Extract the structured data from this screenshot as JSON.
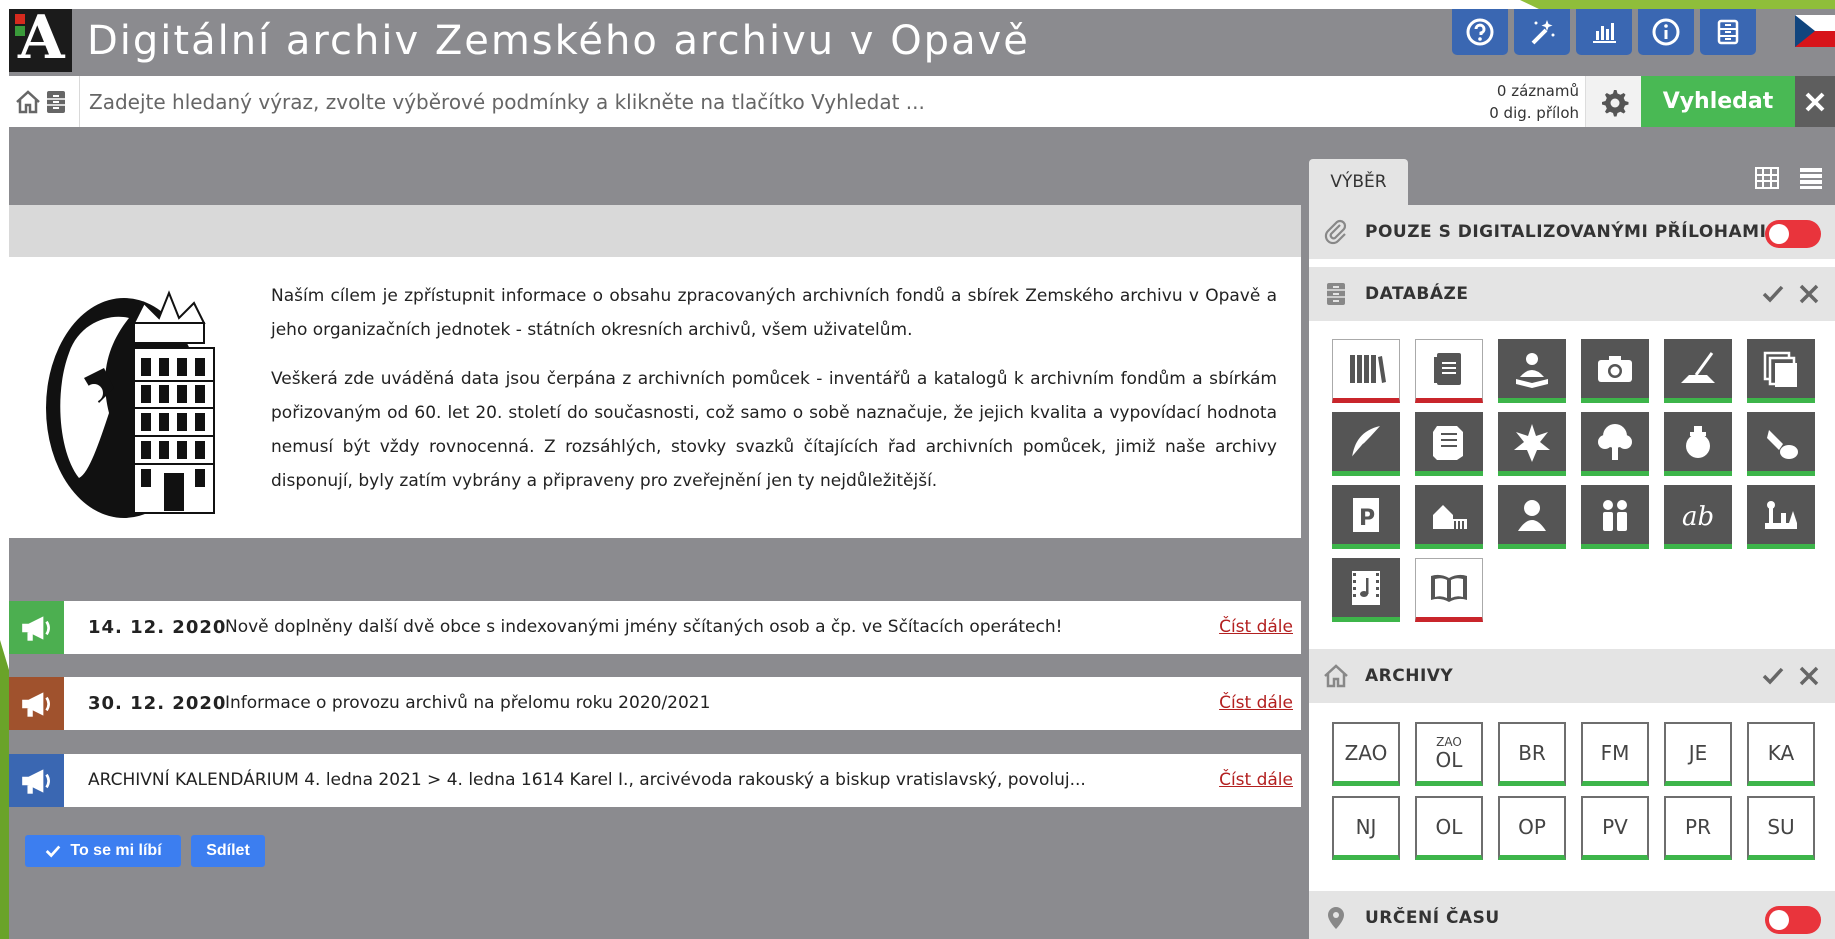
{
  "header": {
    "title": "Digitální archiv  Zemského archivu v Opavě",
    "logo_letter": "A",
    "buttons": [
      {
        "name": "help-button",
        "icon": "question-icon"
      },
      {
        "name": "magic-wand-button",
        "icon": "magic-wand-icon"
      },
      {
        "name": "statistics-button",
        "icon": "bar-chart-icon"
      },
      {
        "name": "info-button",
        "icon": "info-icon"
      },
      {
        "name": "archive-button",
        "icon": "cabinet-icon"
      }
    ],
    "language_flag": "czech-flag-icon",
    "button_color": "#3a67b2"
  },
  "search": {
    "placeholder": "Zadejte hledaný výraz, zvolte výběrové podmínky a klikněte na tlačítko Vyhledat ...",
    "records": "0 záznamů",
    "attachments": "0 dig. příloh",
    "search_label": "Vyhledat",
    "search_color": "#49b954"
  },
  "intro": {
    "paragraph1": "Naším cílem je zpřístupnit informace o obsahu zpracovaných archivních fondů a sbírek Zemského archivu v Opavě a jeho organizačních jednotek - státních okresních archivů, všem uživatelům.",
    "paragraph2": "Veškerá zde uváděná data jsou čerpána z archivních pomůcek - inventářů a katalogů k archivním fondům a sbírkám pořizovaným od 60. let 20. století do současnosti, což samo o sobě naznačuje, že jejich kvalita a vypovídací hodnota nemusí být vždy rovnocenná. Z rozsáhlých, stovky svazků čítajících řad archivních pomůcek, jimiž naše archivy disponují, byly zatím vybrány a připraveny pro zveřejnění jen ty nejdůležitější."
  },
  "news": [
    {
      "date": "14. 12. 2020",
      "text": "Nově doplněny další dvě obce s indexovanými jmény sčítaných osob a čp. ve Sčítacích operátech!",
      "more": "Číst dále",
      "color": "#4caf50"
    },
    {
      "date": "30. 12. 2020",
      "text": "Informace o provozu archivů na přelomu roku 2020/2021",
      "more": "Číst dále",
      "color": "#a0522d"
    },
    {
      "date": "",
      "text": "ARCHIVNÍ KALENDÁRIUM 4. ledna 2021 > 4. ledna 1614 Karel I., arcivévoda rakouský a biskup vratislavský, povoluj...",
      "more": "Číst dále",
      "color": "#3a67b2"
    }
  ],
  "social": {
    "like": "To se mi líbí",
    "share": "Sdílet"
  },
  "panel": {
    "tab": "VÝBĚR",
    "digital_only": "POUZE S DIGITALIZOVANÝMI PŘÍLOHAMI",
    "databases_title": "DATABÁZE",
    "databases": [
      {
        "icon": "books-icon",
        "selected": false
      },
      {
        "icon": "ledger-icon",
        "selected": false
      },
      {
        "icon": "reader-icon",
        "selected": true
      },
      {
        "icon": "camera-icon",
        "selected": true
      },
      {
        "icon": "drafting-icon",
        "selected": true
      },
      {
        "icon": "documents-stack-icon",
        "selected": true
      },
      {
        "icon": "quill-icon",
        "selected": true
      },
      {
        "icon": "scroll-icon",
        "selected": true
      },
      {
        "icon": "seal-star-icon",
        "selected": true
      },
      {
        "icon": "tree-icon",
        "selected": true
      },
      {
        "icon": "wax-seal-icon",
        "selected": true
      },
      {
        "icon": "stamp-icon",
        "selected": true
      },
      {
        "icon": "poster-icon",
        "selected": true
      },
      {
        "icon": "map-building-icon",
        "selected": true
      },
      {
        "icon": "person-icon",
        "selected": true
      },
      {
        "icon": "family-icon",
        "selected": true
      },
      {
        "icon": "handwriting-icon",
        "selected": true
      },
      {
        "icon": "landscape-icon",
        "selected": true
      },
      {
        "icon": "film-music-icon",
        "selected": true
      },
      {
        "icon": "open-book-icon",
        "selected": false
      }
    ],
    "archives_title": "ARCHIVY",
    "archives": [
      {
        "sup": "",
        "code": "ZAO"
      },
      {
        "sup": "ZAO",
        "code": "OL"
      },
      {
        "sup": "",
        "code": "BR"
      },
      {
        "sup": "",
        "code": "FM"
      },
      {
        "sup": "",
        "code": "JE"
      },
      {
        "sup": "",
        "code": "KA"
      },
      {
        "sup": "",
        "code": "NJ"
      },
      {
        "sup": "",
        "code": "OL"
      },
      {
        "sup": "",
        "code": "OP"
      },
      {
        "sup": "",
        "code": "PV"
      },
      {
        "sup": "",
        "code": "PR"
      },
      {
        "sup": "",
        "code": "SU"
      }
    ],
    "time_title": "URČENÍ ČASU"
  }
}
